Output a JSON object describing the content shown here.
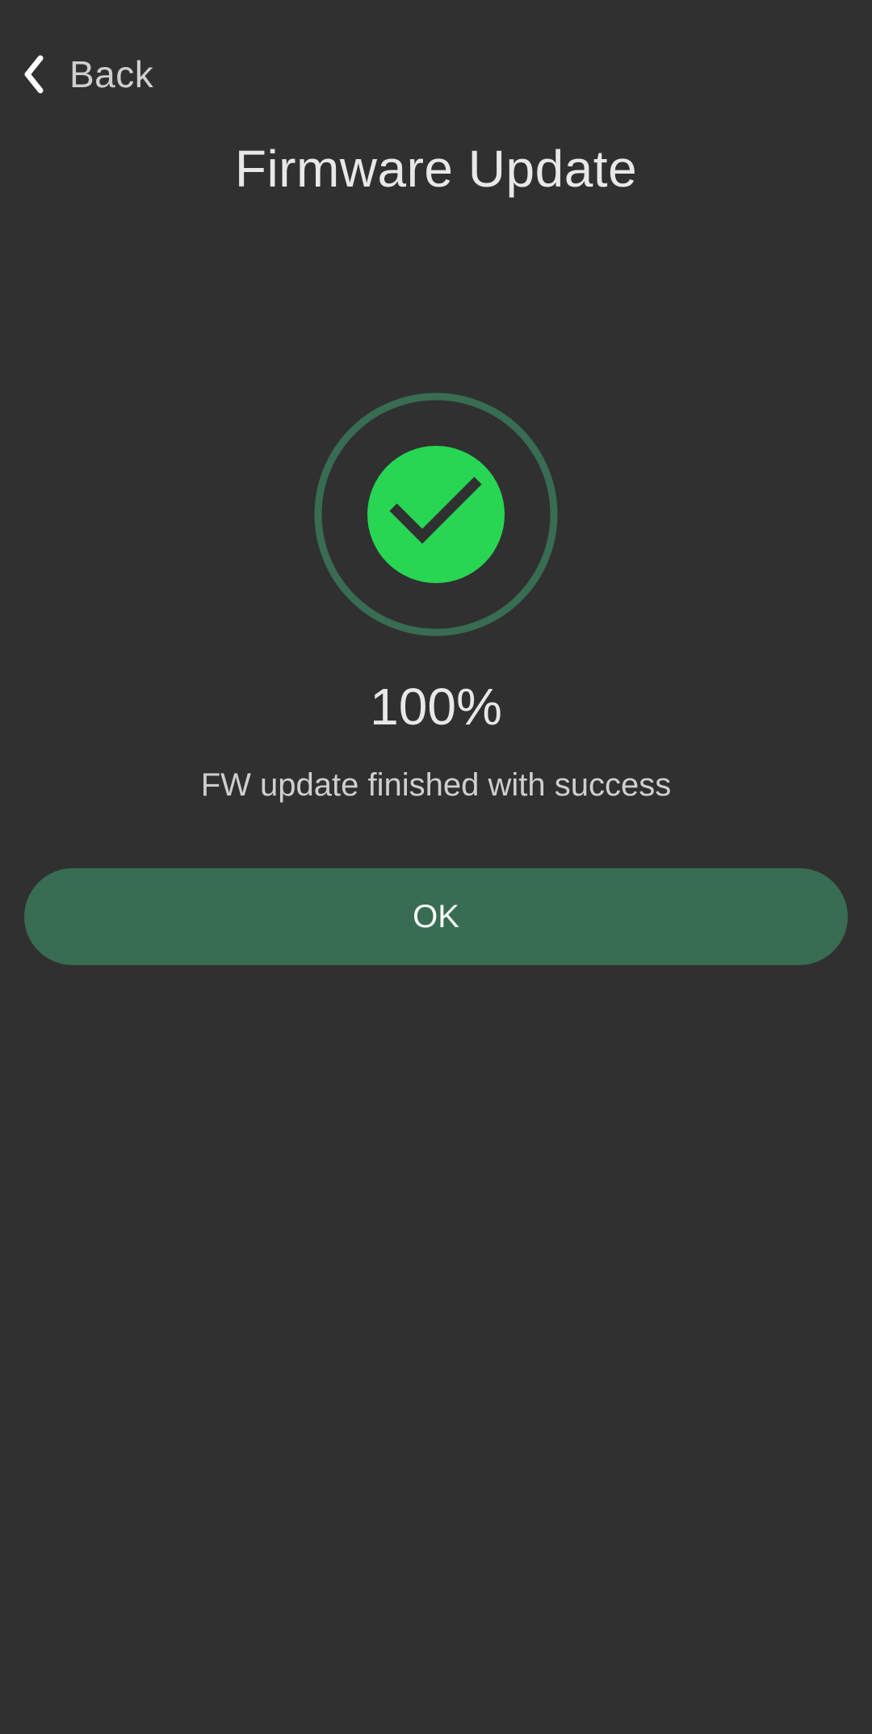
{
  "header": {
    "back_label": "Back",
    "title": "Firmware Update"
  },
  "status": {
    "progress_text": "100%",
    "progress_fraction": 1.0,
    "message": "FW update finished with success",
    "icon": "success-check-icon"
  },
  "actions": {
    "ok_label": "OK"
  },
  "colors": {
    "background": "#303030",
    "accent_green": "#27d653",
    "ring_green": "#386c53",
    "button_green": "#386c53",
    "text": "#e8e8e8"
  }
}
